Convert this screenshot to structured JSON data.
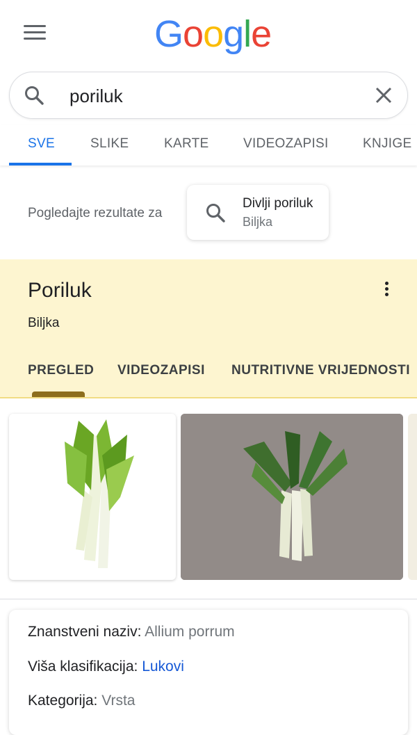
{
  "logo": {
    "letters": [
      "G",
      "o",
      "o",
      "g",
      "l",
      "e"
    ],
    "colors": [
      "#4285F4",
      "#EA4335",
      "#FBBC05",
      "#4285F4",
      "#34A853",
      "#EA4335"
    ]
  },
  "search": {
    "value": "poriluk"
  },
  "tabs": [
    {
      "label": "SVE",
      "active": true
    },
    {
      "label": "SLIKE"
    },
    {
      "label": "KARTE"
    },
    {
      "label": "VIDEOZAPISI"
    },
    {
      "label": "KNJIGE"
    }
  ],
  "see_results": {
    "prefix": "Pogledajte rezultate za",
    "title": "Divlji poriluk",
    "subtitle": "Biljka"
  },
  "knowledge_panel": {
    "title": "Poriluk",
    "subtitle": "Biljka",
    "tabs": [
      "PREGLED",
      "VIDEOZAPISI",
      "NUTRITIVNE VRIJEDNOSTI"
    ],
    "active_tab": "PREGLED",
    "accent_color": "#fdf5d0"
  },
  "facts": {
    "scientific_label": "Znanstveni naziv:",
    "scientific_value": "Allium porrum",
    "classification_label": "Viša klasifikacija:",
    "classification_value": "Lukovi",
    "category_label": "Kategorija:",
    "category_value": "Vrsta"
  },
  "icons": [
    "menu-icon",
    "search-icon",
    "close-icon",
    "more-vert-icon"
  ],
  "colors": {
    "accent_blue": "#1a73e8",
    "link_blue": "#1558d6"
  }
}
